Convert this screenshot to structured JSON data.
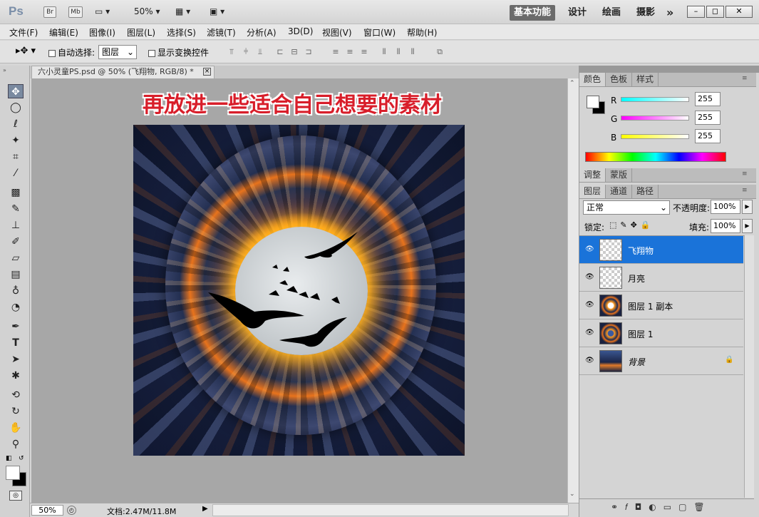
{
  "titlebar": {
    "ps": "Ps",
    "br": "Br",
    "mb": "Mb",
    "zoom": "50%",
    "workspaces": [
      "基本功能",
      "设计",
      "绘画",
      "摄影"
    ],
    "more": "»"
  },
  "menu": [
    "文件(F)",
    "编辑(E)",
    "图像(I)",
    "图层(L)",
    "选择(S)",
    "滤镜(T)",
    "分析(A)",
    "3D(D)",
    "视图(V)",
    "窗口(W)",
    "帮助(H)"
  ],
  "options": {
    "auto_select_label": "自动选择:",
    "auto_select_value": "图层",
    "show_transform": "显示变换控件"
  },
  "document": {
    "tab_title": "六小灵童PS.psd @ 50% (飞翔物, RGB/8) *",
    "caption": "再放进一些适合自己想要的素材"
  },
  "status": {
    "zoom": "50%",
    "doc": "文档:2.47M/11.8M"
  },
  "color_panel": {
    "tabs": [
      "颜色",
      "色板",
      "样式"
    ],
    "r_label": "R",
    "g_label": "G",
    "b_label": "B",
    "r": "255",
    "g": "255",
    "b": "255"
  },
  "adjust_panel": {
    "tabs": [
      "调整",
      "蒙版"
    ]
  },
  "layers_panel": {
    "tabs": [
      "图层",
      "通道",
      "路径"
    ],
    "blend": "正常",
    "opacity_label": "不透明度:",
    "opacity": "100%",
    "lock_label": "锁定:",
    "fill_label": "填充:",
    "fill": "100%",
    "layers": [
      {
        "name": "飞翔物"
      },
      {
        "name": "月亮"
      },
      {
        "name": "图层 1 副本"
      },
      {
        "name": "图层 1"
      },
      {
        "name": "背景"
      }
    ]
  },
  "colors": {
    "selected_layer": "#1a73d9",
    "caption": "#d81e2a"
  }
}
